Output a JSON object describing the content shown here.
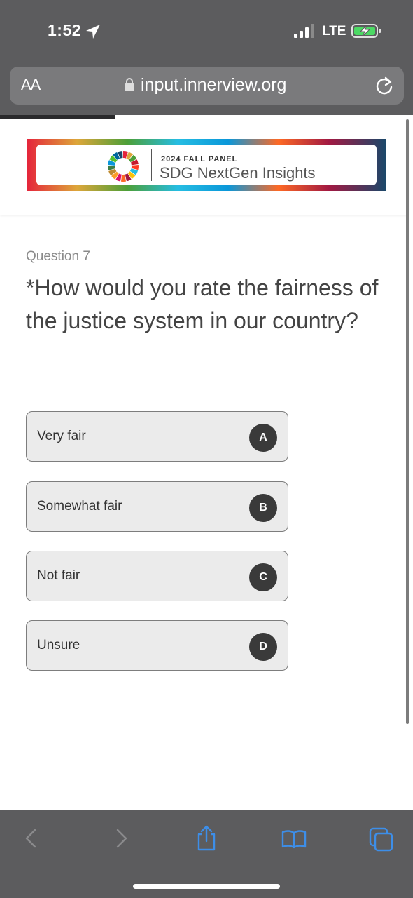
{
  "status_bar": {
    "time": "1:52",
    "network": "LTE"
  },
  "browser": {
    "text_size_label": "AA",
    "url": "input.innerview.org",
    "load_progress": 0.28
  },
  "banner": {
    "kicker": "2024 FALL PANEL",
    "title": "SDG NextGen Insights"
  },
  "question": {
    "number_label": "Question 7",
    "text": "*How would you rate the fairness of the justice system in our country?",
    "options": [
      {
        "label": "Very fair",
        "key": "A"
      },
      {
        "label": "Somewhat fair",
        "key": "B"
      },
      {
        "label": "Not fair",
        "key": "C"
      },
      {
        "label": "Unsure",
        "key": "D"
      }
    ]
  },
  "colors": {
    "chrome": "#5c5c5e",
    "toolbar_accent": "#3d8ee8",
    "option_bg": "#ebebeb",
    "key_badge": "#3a3a3a"
  },
  "icons": [
    "location-arrow-icon",
    "signal-icon",
    "battery-charging-icon",
    "lock-icon",
    "reload-icon",
    "back-icon",
    "forward-icon",
    "share-icon",
    "bookmarks-icon",
    "tabs-icon"
  ]
}
